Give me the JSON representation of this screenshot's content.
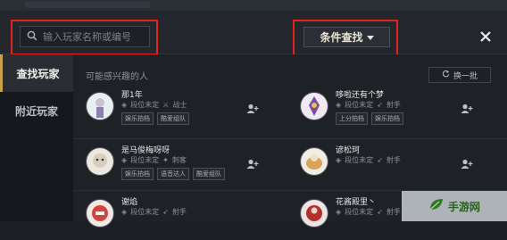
{
  "search": {
    "placeholder": "输入玩家名称或编号"
  },
  "filter": {
    "label": "条件查找"
  },
  "sidebar": {
    "items": [
      {
        "label": "查找玩家"
      },
      {
        "label": "附近玩家"
      }
    ]
  },
  "section": {
    "title": "可能感兴趣的人",
    "refresh_label": "换一批"
  },
  "players": [
    {
      "name": "那1年",
      "rank": "段位未定",
      "role": "战士",
      "tags": [
        "娱乐拍档",
        "酷爱组队"
      ]
    },
    {
      "name": "哆啦还有个梦",
      "rank": "段位未定",
      "role": "射手",
      "tags": [
        "上分拍档",
        "娱乐拍档"
      ]
    },
    {
      "name": "是马俊梅呀呀",
      "rank": "段位未定",
      "role": "刺客",
      "tags": [
        "娱乐拍档",
        "语音达人",
        "酷爱组队"
      ]
    },
    {
      "name": "谚松珂",
      "rank": "段位未定",
      "role": "射手",
      "tags": []
    },
    {
      "name": "谢焰",
      "rank": "段位未定",
      "role": "射手",
      "tags": []
    },
    {
      "name": "花酱殿里丶",
      "rank": "段位未定",
      "role": "射手",
      "tags": []
    }
  ],
  "watermark": {
    "text": "手游网"
  },
  "colors": {
    "accent": "#c9a24a",
    "highlight_box": "#e0251c"
  }
}
